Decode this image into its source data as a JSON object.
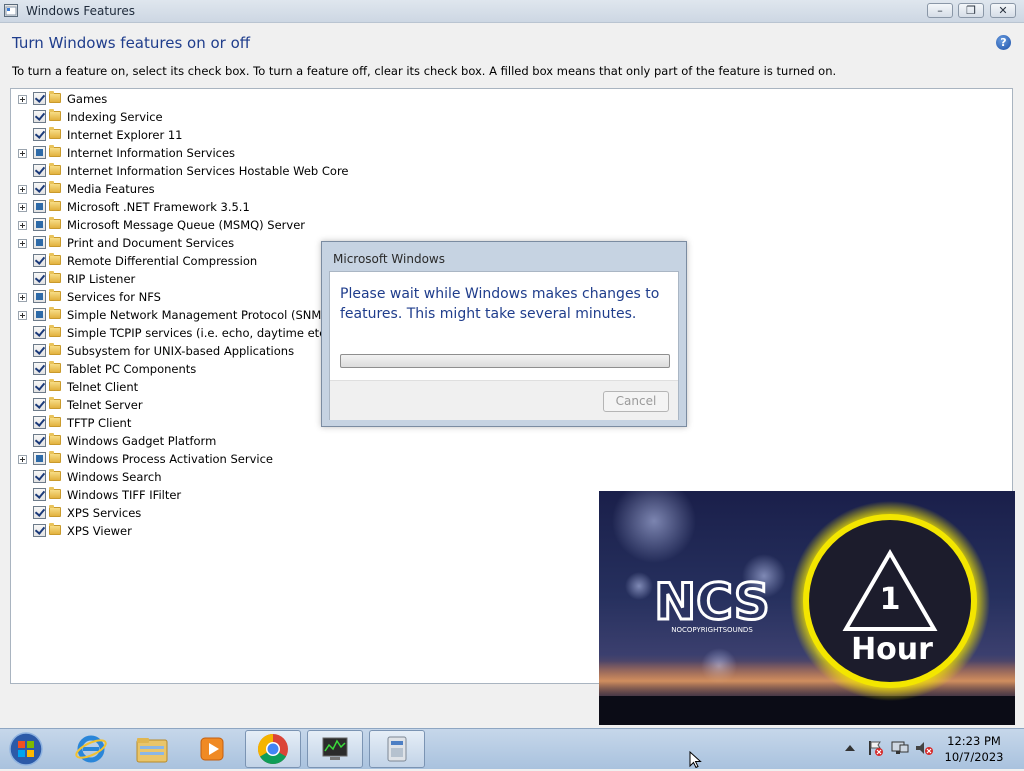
{
  "window": {
    "title": "Windows Features",
    "heading": "Turn Windows features on or off",
    "description": "To turn a feature on, select its check box. To turn a feature off, clear its check box. A filled box means that only part of the feature is turned on.",
    "buttons": {
      "minimize": "–",
      "maximize": "❐",
      "close": "✕"
    },
    "help_icon": "?"
  },
  "features": [
    {
      "label": "Games",
      "state": "checked",
      "expandable": true
    },
    {
      "label": "Indexing Service",
      "state": "checked",
      "expandable": false
    },
    {
      "label": "Internet Explorer 11",
      "state": "checked",
      "expandable": false
    },
    {
      "label": "Internet Information Services",
      "state": "partial",
      "expandable": true
    },
    {
      "label": "Internet Information Services Hostable Web Core",
      "state": "checked",
      "expandable": false
    },
    {
      "label": "Media Features",
      "state": "checked",
      "expandable": true
    },
    {
      "label": "Microsoft .NET Framework 3.5.1",
      "state": "partial",
      "expandable": true
    },
    {
      "label": "Microsoft Message Queue (MSMQ) Server",
      "state": "partial",
      "expandable": true
    },
    {
      "label": "Print and Document Services",
      "state": "partial",
      "expandable": true
    },
    {
      "label": "Remote Differential Compression",
      "state": "checked",
      "expandable": false
    },
    {
      "label": "RIP Listener",
      "state": "checked",
      "expandable": false
    },
    {
      "label": "Services for NFS",
      "state": "partial",
      "expandable": true
    },
    {
      "label": "Simple Network Management Protocol (SNMP)",
      "state": "partial",
      "expandable": true
    },
    {
      "label": "Simple TCPIP services (i.e. echo, daytime etc)",
      "state": "checked",
      "expandable": false
    },
    {
      "label": "Subsystem for UNIX-based Applications",
      "state": "checked",
      "expandable": false
    },
    {
      "label": "Tablet PC Components",
      "state": "checked",
      "expandable": false
    },
    {
      "label": "Telnet Client",
      "state": "checked",
      "expandable": false
    },
    {
      "label": "Telnet Server",
      "state": "checked",
      "expandable": false
    },
    {
      "label": "TFTP Client",
      "state": "checked",
      "expandable": false
    },
    {
      "label": "Windows Gadget Platform",
      "state": "checked",
      "expandable": false
    },
    {
      "label": "Windows Process Activation Service",
      "state": "partial",
      "expandable": true
    },
    {
      "label": "Windows Search",
      "state": "checked",
      "expandable": false
    },
    {
      "label": "Windows TIFF IFilter",
      "state": "checked",
      "expandable": false
    },
    {
      "label": "XPS Services",
      "state": "checked",
      "expandable": false
    },
    {
      "label": "XPS Viewer",
      "state": "checked",
      "expandable": false
    }
  ],
  "dialog": {
    "title": "Microsoft Windows",
    "message": "Please wait while Windows makes changes to features. This might take several minutes.",
    "progress": 0,
    "cancel_label": "Cancel"
  },
  "video": {
    "logo": "NCS",
    "logo_tagline": "NOCOPYRIGHTSOUNDS",
    "badge_number": "1",
    "badge_text": "Hour",
    "accent": "#f3e600"
  },
  "taskbar": {
    "start_icon": "windows-start-orb",
    "pinned": [
      "internet-explorer-icon",
      "file-explorer-icon",
      "media-player-icon",
      "chrome-icon",
      "task-manager-icon",
      "control-panel-icon"
    ],
    "tray_time": "12:23 PM",
    "tray_date": "10/7/2023"
  }
}
